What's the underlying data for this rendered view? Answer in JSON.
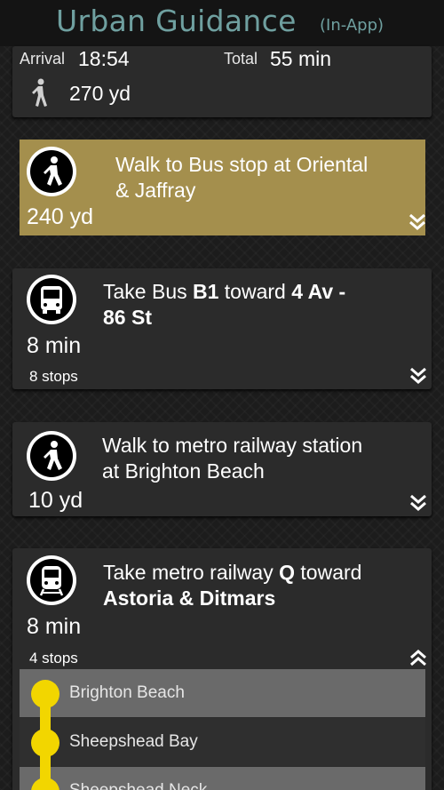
{
  "header": {
    "title": "Urban Guidance",
    "subtitle": "(In-App)",
    "title_color": "#6fa0a0"
  },
  "summary": {
    "arrival_label": "Arrival",
    "arrival_time": "18:54",
    "total_label": "Total",
    "total_time": "55 min",
    "walk_distance": "270 yd",
    "icon": "walking-person-icon"
  },
  "steps": [
    {
      "icon": "pedestrian-icon",
      "line1": "Walk to Bus stop at Oriental",
      "line2": "& Jaffray",
      "distance": "240 yd",
      "highlighted": true,
      "highlight_color": "#a48f4d"
    },
    {
      "icon": "bus-icon",
      "prefix": "Take Bus ",
      "route": "B1",
      "middle": " toward ",
      "dest_line1": "4 Av -",
      "dest_line2": "86 St",
      "duration": "8 min",
      "stops": "8 stops"
    },
    {
      "icon": "pedestrian-icon",
      "line1": "Walk to metro railway station",
      "line2": "at Brighton Beach",
      "distance": "10 yd"
    },
    {
      "icon": "metro-train-icon",
      "prefix": "Take metro railway ",
      "route": "Q",
      "middle": " toward",
      "dest_line2": "Astoria & Ditmars",
      "duration": "8 min",
      "stops": "4 stops",
      "expanded": true,
      "stop_list": [
        "Brighton Beach",
        "Sheepshead Bay",
        "Sheepshead Neck"
      ]
    }
  ],
  "line_color": "#f2d600"
}
